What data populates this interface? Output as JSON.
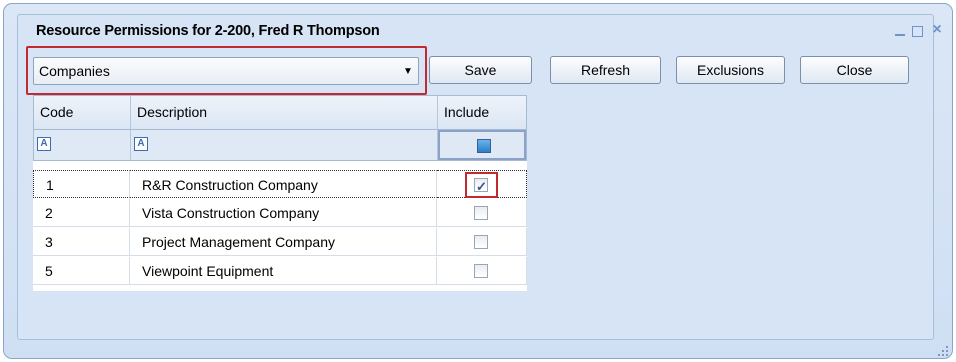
{
  "window": {
    "title": "Resource Permissions for 2-200, Fred R Thompson",
    "controls": {
      "minimize": "_",
      "maximize": "□",
      "close": "×"
    }
  },
  "toolbar": {
    "combo_value": "Companies",
    "save_label": "Save",
    "refresh_label": "Refresh",
    "exclusions_label": "Exclusions",
    "close_label": "Close"
  },
  "grid": {
    "columns": [
      "Code",
      "Description",
      "Include"
    ],
    "filter_icon": "A",
    "rows": [
      {
        "code": "1",
        "description": "R&R Construction Company",
        "include": true
      },
      {
        "code": "2",
        "description": "Vista Construction Company",
        "include": false
      },
      {
        "code": "3",
        "description": "Project Management Company",
        "include": false
      },
      {
        "code": "5",
        "description": "Viewpoint Equipment",
        "include": false
      }
    ]
  },
  "colors": {
    "highlight": "#c22a32",
    "accent": "#2a7fc8",
    "window_border": "#8aa5c8"
  }
}
